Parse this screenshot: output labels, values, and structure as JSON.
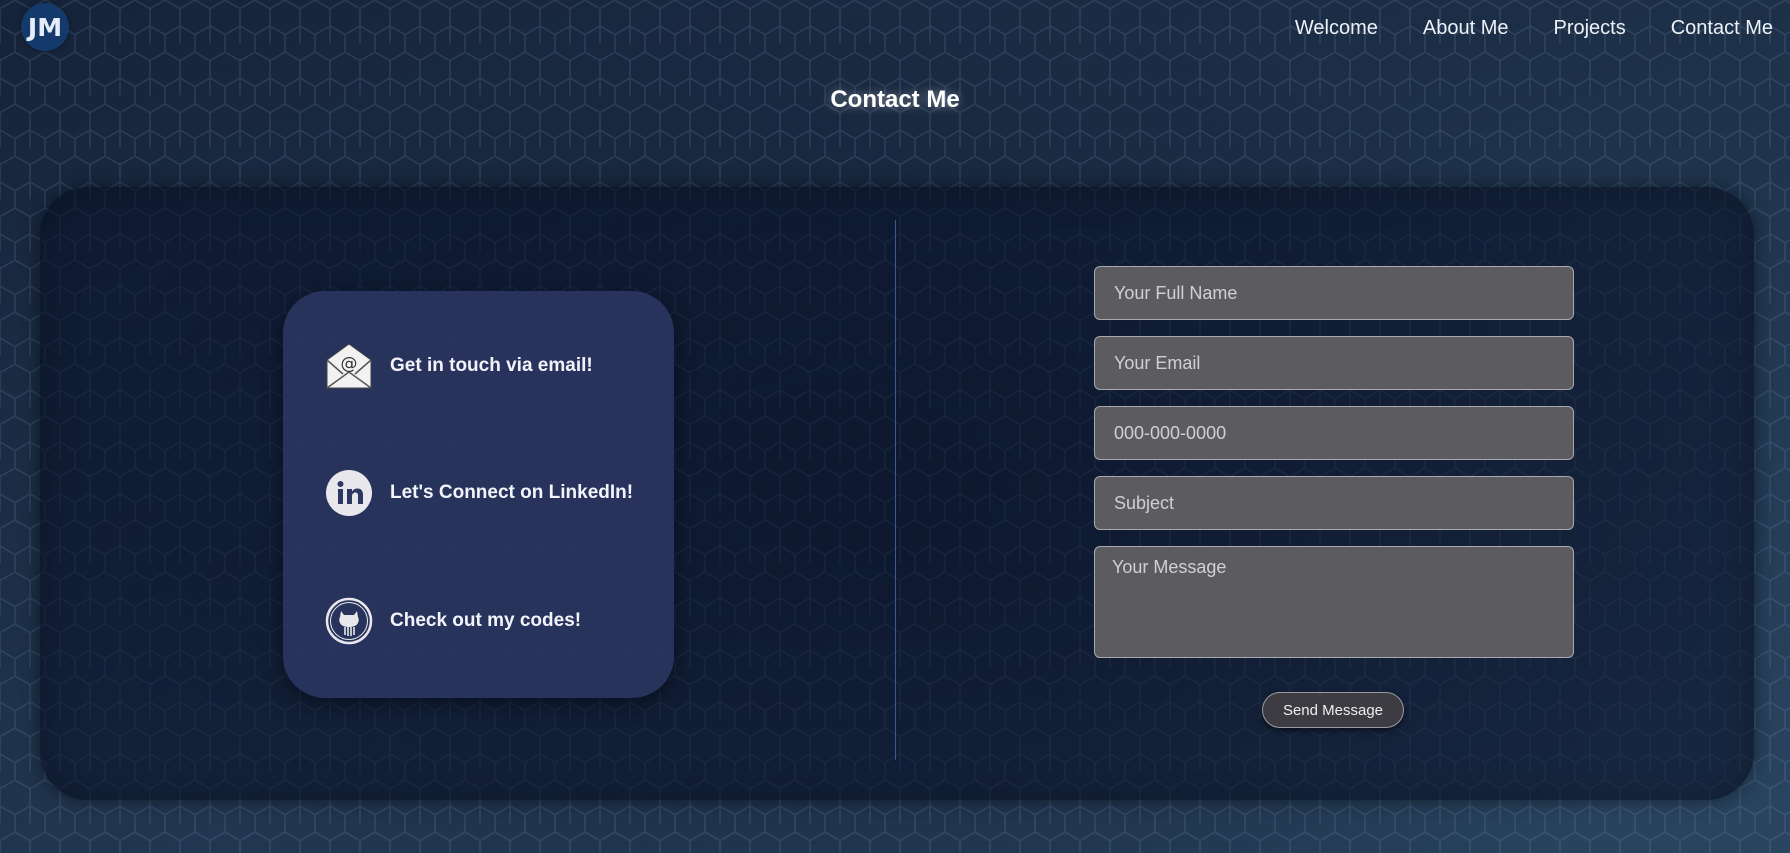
{
  "logo": {
    "text": "JM"
  },
  "nav": {
    "items": [
      "Welcome",
      "About Me",
      "Projects",
      "Contact Me"
    ]
  },
  "page": {
    "title": "Contact Me"
  },
  "contact_card": {
    "email_label": "Get in touch via email!",
    "linkedin_label": "Let's Connect on LinkedIn!",
    "github_label": "Check out my codes!",
    "icons": [
      "email-envelope-icon",
      "linkedin-icon",
      "github-icon"
    ]
  },
  "form": {
    "name_placeholder": "Your Full Name",
    "email_placeholder": "Your Email",
    "phone_placeholder": "000-000-0000",
    "subject_placeholder": "Subject",
    "message_placeholder": "Your Message",
    "send_label": "Send Message"
  },
  "colors": {
    "background": "#1b2a3e",
    "card": "#2d3764",
    "input": "#5c5c60",
    "logo": "#133a6b"
  }
}
